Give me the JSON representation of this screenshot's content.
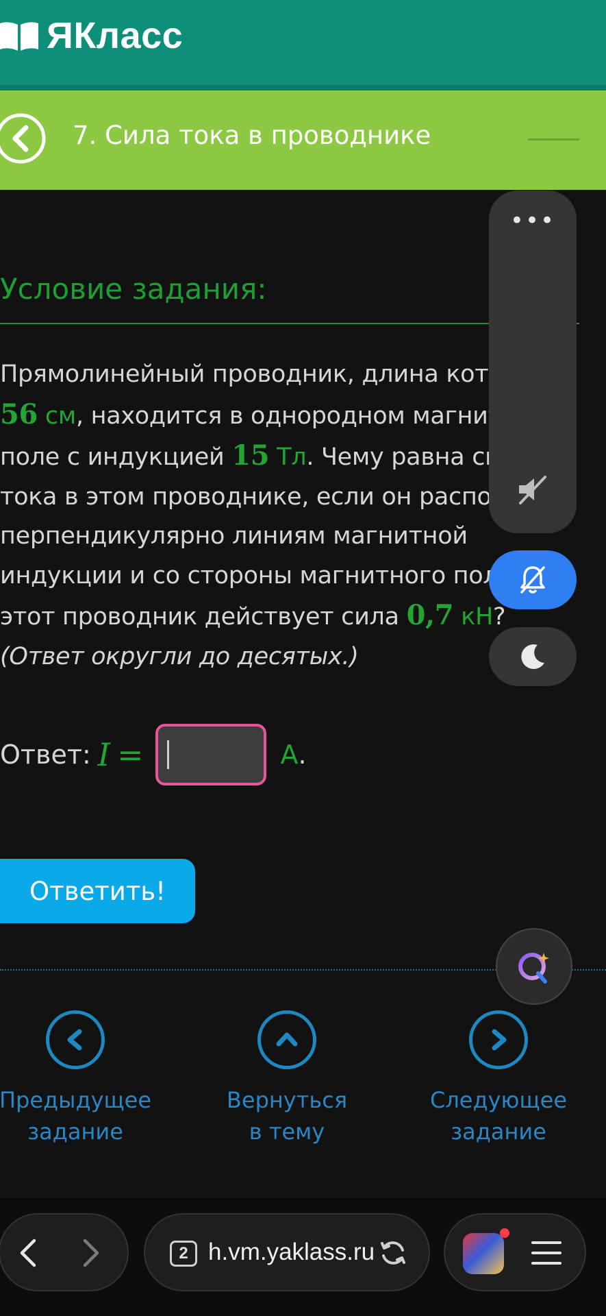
{
  "header": {
    "logo_text": "ЯКласс"
  },
  "lesson": {
    "title": "7. Сила тока в проводнике"
  },
  "task": {
    "heading": "Условие задания:",
    "text": {
      "p1": "Прямолинейный проводник, длина которого ",
      "length_value": "56",
      "length_unit": "см",
      "p2": ", находится в однородном магнитном поле с индукцией ",
      "induction_value": "15",
      "induction_unit": "Тл",
      "p3": ". Чему равна сила тока в этом проводнике, если он расположен перпендикулярно линиям магнитной индукции и со стороны магнитного поля на этот проводник действует сила ",
      "force_value": "0,7",
      "force_unit": "кН",
      "p4": "?",
      "note": "(Ответ округли до десятых.)"
    }
  },
  "answer": {
    "label": "Ответ:",
    "variable": "I",
    "equals": "=",
    "value": "",
    "unit": "А",
    "dot": "."
  },
  "buttons": {
    "submit": "Ответить!"
  },
  "navigation": {
    "prev_line1": "Предыдущее",
    "prev_line2": "задание",
    "up_line1": "Вернуться",
    "up_line2": "в тему",
    "next_line1": "Следующее",
    "next_line2": "задание"
  },
  "floating_panel": {
    "more_label": "•••"
  },
  "browser": {
    "tab_count": "2",
    "url": "h.vm.yaklass.ru"
  },
  "colors": {
    "header": "#0e8f7a",
    "lesson_bar": "#8dc843",
    "accent_green": "#23a536",
    "submit": "#0aa9e8",
    "nav_blue": "#1d88c2",
    "input_border": "#e8569a"
  }
}
